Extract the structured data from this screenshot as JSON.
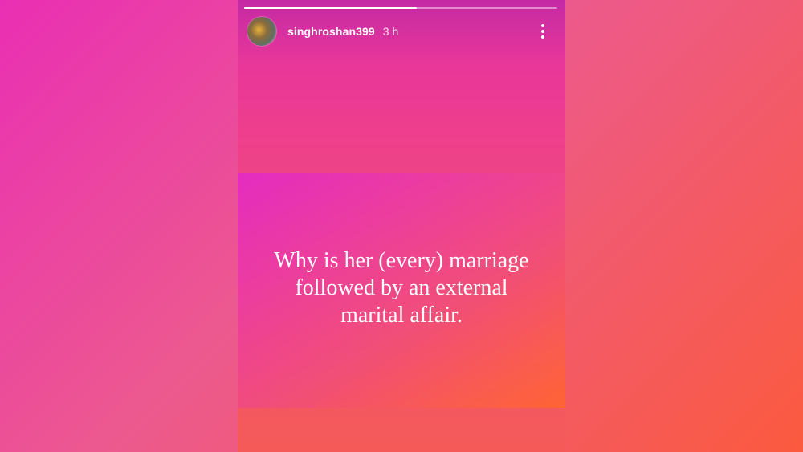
{
  "story": {
    "progress": 0.55,
    "author": {
      "username": "singhroshan399",
      "timestamp": "3 h"
    },
    "post": {
      "line1": "Why is her (every) marriage",
      "line2": "followed by an external",
      "line3": "marital affair."
    }
  },
  "colors": {
    "gradient_pink": "#e42cc0",
    "gradient_orange": "#ff6434",
    "text": "#ffffff"
  },
  "icons": {
    "avatar": "avatar",
    "menu": "more-vertical-icon"
  }
}
